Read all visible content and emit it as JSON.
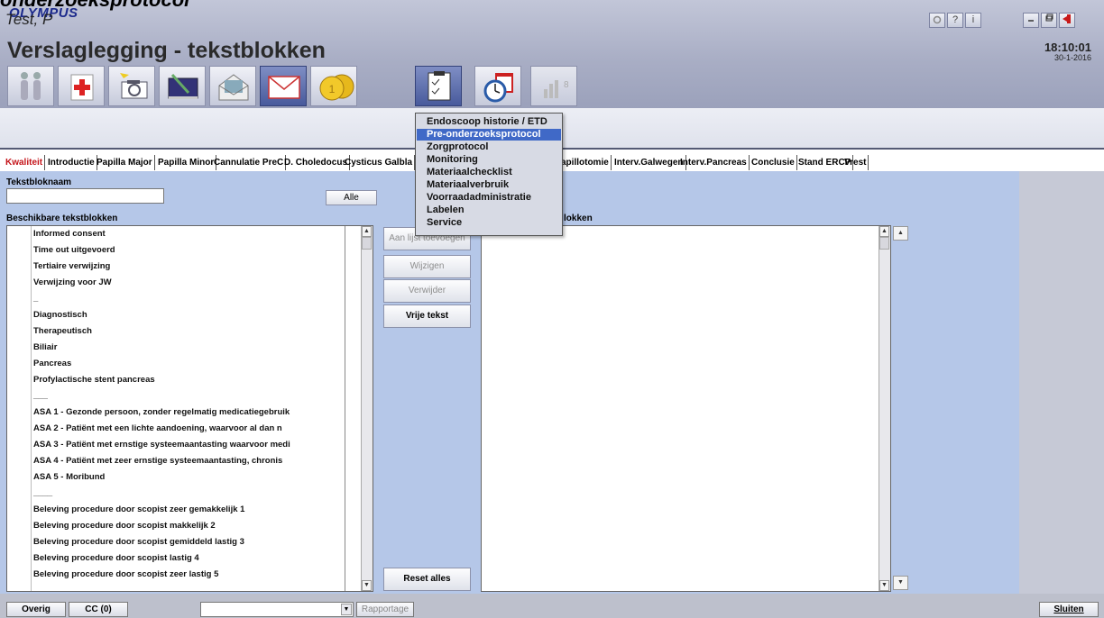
{
  "clipped_title": "onderzoeksprotocol",
  "header": {
    "logo": "OLYMPUS",
    "title": "Verslaglegging - tekstblokken",
    "time": "18:10:01",
    "date": "30-1-2016",
    "window_buttons": [
      "?",
      "i"
    ]
  },
  "toolbar_icons": [
    "patients-icon",
    "medical-kit-icon",
    "camera-icon",
    "video-icon",
    "image-envelope-icon",
    "envelope-icon",
    "coins-icon",
    "clipboard-icon",
    "calendar-clock-icon",
    "statistics-icon"
  ],
  "patient": {
    "name": "Test, P"
  },
  "tabs": [
    "Kwaliteit",
    "Introductie",
    "Papilla Major",
    "Papilla Minor",
    "Cannulatie PreC",
    "D. Choledocus",
    "Cysticus Galbla",
    "apillotomie",
    "Interv.Galwegen",
    "Interv.Pancreas",
    "Conclusie",
    "Stand ERCP",
    "Vrest"
  ],
  "form": {
    "name_label": "Tekstbloknaam",
    "all_button": "Alle",
    "available_label": "Beschikbare tekstblokken",
    "selected_label": "lokken"
  },
  "available_items": [
    "Informed consent",
    "Time out uitgevoerd",
    "Tertiaire verwijzing",
    "Verwijzing voor JW",
    "_",
    "Diagnostisch",
    "Therapeutisch",
    "Biliair",
    "Pancreas",
    "Profylactische stent pancreas",
    "___",
    "ASA 1 - Gezonde persoon, zonder regelmatig medicatiegebruik",
    "ASA 2 - Patiënt met een lichte aandoening, waarvoor al dan n",
    "ASA 3 - Patiënt met ernstige systeemaantasting waarvoor medi",
    "ASA 4 - Patiënt met zeer ernstige systeemaantasting, chronis",
    "ASA 5 - Moribund",
    "____",
    "Beleving procedure door scopist zeer gemakkelijk 1",
    "Beleving procedure door scopist makkelijk 2",
    "Beleving procedure door scopist gemiddeld lastig 3",
    "Beleving procedure door scopist lastig 4",
    "Beleving procedure door scopist zeer lastig 5",
    "_____"
  ],
  "actions": {
    "add": "Aan lijst toevoegen",
    "edit": "Wijzigen",
    "delete": "Verwijder",
    "free_text": "Vrije tekst",
    "reset": "Reset alles"
  },
  "menu_items": [
    "Endoscoop historie / ETD",
    "Pre-onderzoeksprotocol",
    "Zorgprotocol",
    "Monitoring",
    "Materiaalchecklist",
    "Materiaalverbruik",
    "Voorraadadministratie",
    "Labelen",
    "Service"
  ],
  "menu_highlighted": "Pre-onderzoeksprotocol",
  "bottom": {
    "overig": "Overig",
    "cc": "CC (0)",
    "rapportage": "Rapportage",
    "sluiten": "Sluiten"
  },
  "colors": {
    "active_tab": "#c4141a",
    "menu_highlight": "#4069c7",
    "panel": "#b5c7e8"
  }
}
